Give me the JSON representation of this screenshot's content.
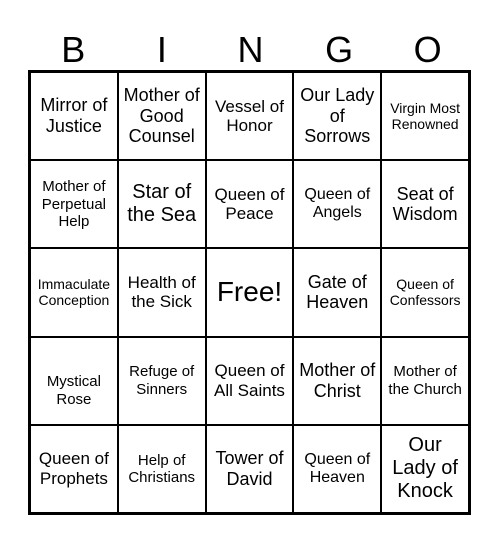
{
  "header": [
    "B",
    "I",
    "N",
    "G",
    "O"
  ],
  "cells": [
    "Mirror of Justice",
    "Mother of Good Counsel",
    "Vessel of Honor",
    "Our Lady of Sorrows",
    "Virgin Most Renowned",
    "Mother of Perpetual Help",
    "Star of the Sea",
    "Queen of Peace",
    "Queen of Angels",
    "Seat of Wisdom",
    "Immaculate Conception",
    "Health of the Sick",
    "Free!",
    "Gate of Heaven",
    "Queen of Confessors",
    "Mystical Rose",
    "Refuge of Sinners",
    "Queen of All Saints",
    "Mother of Christ",
    "Mother of the Church",
    "Queen of Prophets",
    "Help of Christians",
    "Tower of David",
    "Queen of Heaven",
    "Our Lady of Knock"
  ]
}
